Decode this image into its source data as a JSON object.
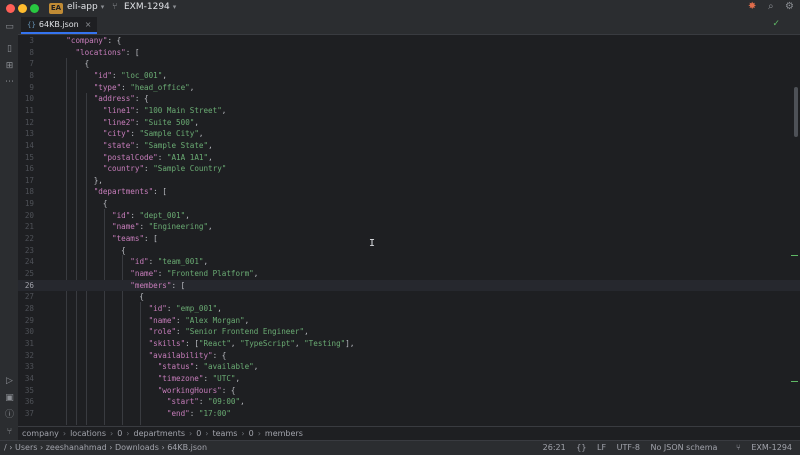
{
  "titlebar": {
    "project_badge": "EA",
    "project_name": "eli-app",
    "branch": "EXM-1294"
  },
  "tab": {
    "filename": "64KB.json"
  },
  "code_lines": [
    {
      "n": "3",
      "text": "    \"company\": {",
      "cls": ""
    },
    {
      "n": "8",
      "text": "      \"locations\": [",
      "cls": ""
    },
    {
      "n": "7",
      "text": "        {",
      "cls": ""
    },
    {
      "n": "8",
      "text": "          \"id\": \"loc_001\",",
      "cls": ""
    },
    {
      "n": "9",
      "text": "          \"type\": \"head_office\",",
      "cls": ""
    },
    {
      "n": "10",
      "text": "          \"address\": {",
      "cls": ""
    },
    {
      "n": "11",
      "text": "            \"line1\": \"100 Main Street\",",
      "cls": ""
    },
    {
      "n": "12",
      "text": "            \"line2\": \"Suite 500\",",
      "cls": ""
    },
    {
      "n": "13",
      "text": "            \"city\": \"Sample City\",",
      "cls": ""
    },
    {
      "n": "14",
      "text": "            \"state\": \"Sample State\",",
      "cls": ""
    },
    {
      "n": "15",
      "text": "            \"postalCode\": \"A1A 1A1\",",
      "cls": ""
    },
    {
      "n": "16",
      "text": "            \"country\": \"Sample Country\"",
      "cls": ""
    },
    {
      "n": "17",
      "text": "          },",
      "cls": ""
    },
    {
      "n": "18",
      "text": "          \"departments\": [",
      "cls": ""
    },
    {
      "n": "19",
      "text": "            {",
      "cls": ""
    },
    {
      "n": "20",
      "text": "              \"id\": \"dept_001\",",
      "cls": ""
    },
    {
      "n": "21",
      "text": "              \"name\": \"Engineering\",",
      "cls": ""
    },
    {
      "n": "22",
      "text": "              \"teams\": [",
      "cls": ""
    },
    {
      "n": "23",
      "text": "                {",
      "cls": ""
    },
    {
      "n": "24",
      "text": "                  \"id\": \"team_001\",",
      "cls": ""
    },
    {
      "n": "25",
      "text": "                  \"name\": \"Frontend Platform\",",
      "cls": ""
    },
    {
      "n": "26",
      "text": "                  \"members\": [",
      "cls": "current"
    },
    {
      "n": "27",
      "text": "                    {",
      "cls": ""
    },
    {
      "n": "28",
      "text": "                      \"id\": \"emp_001\",",
      "cls": ""
    },
    {
      "n": "29",
      "text": "                      \"name\": \"Alex Morgan\",",
      "cls": ""
    },
    {
      "n": "30",
      "text": "                      \"role\": \"Senior Frontend Engineer\",",
      "cls": ""
    },
    {
      "n": "31",
      "text": "                      \"skills\": [\"React\", \"TypeScript\", \"Testing\"],",
      "cls": ""
    },
    {
      "n": "32",
      "text": "                      \"availability\": {",
      "cls": ""
    },
    {
      "n": "33",
      "text": "                        \"status\": \"available\",",
      "cls": ""
    },
    {
      "n": "34",
      "text": "                        \"timezone\": \"UTC\",",
      "cls": ""
    },
    {
      "n": "35",
      "text": "                        \"workingHours\": {",
      "cls": ""
    },
    {
      "n": "36",
      "text": "                          \"start\": \"09:00\",",
      "cls": ""
    },
    {
      "n": "37",
      "text": "                          \"end\": \"17:00\"",
      "cls": ""
    }
  ],
  "breadcrumb": [
    "company",
    "locations",
    "0",
    "departments",
    "0",
    "teams",
    "0",
    "members"
  ],
  "status": {
    "path": [
      "Users",
      "zeeshanahmad",
      "Downloads",
      "64KB.json"
    ],
    "position": "26:21",
    "braces": "{}",
    "line_ending": "LF",
    "encoding": "UTF-8",
    "schema": "No JSON schema",
    "branch": "EXM-1294"
  },
  "colors": {
    "key": "#c77dbb",
    "string": "#6aab73",
    "accent": "#3574f0"
  }
}
